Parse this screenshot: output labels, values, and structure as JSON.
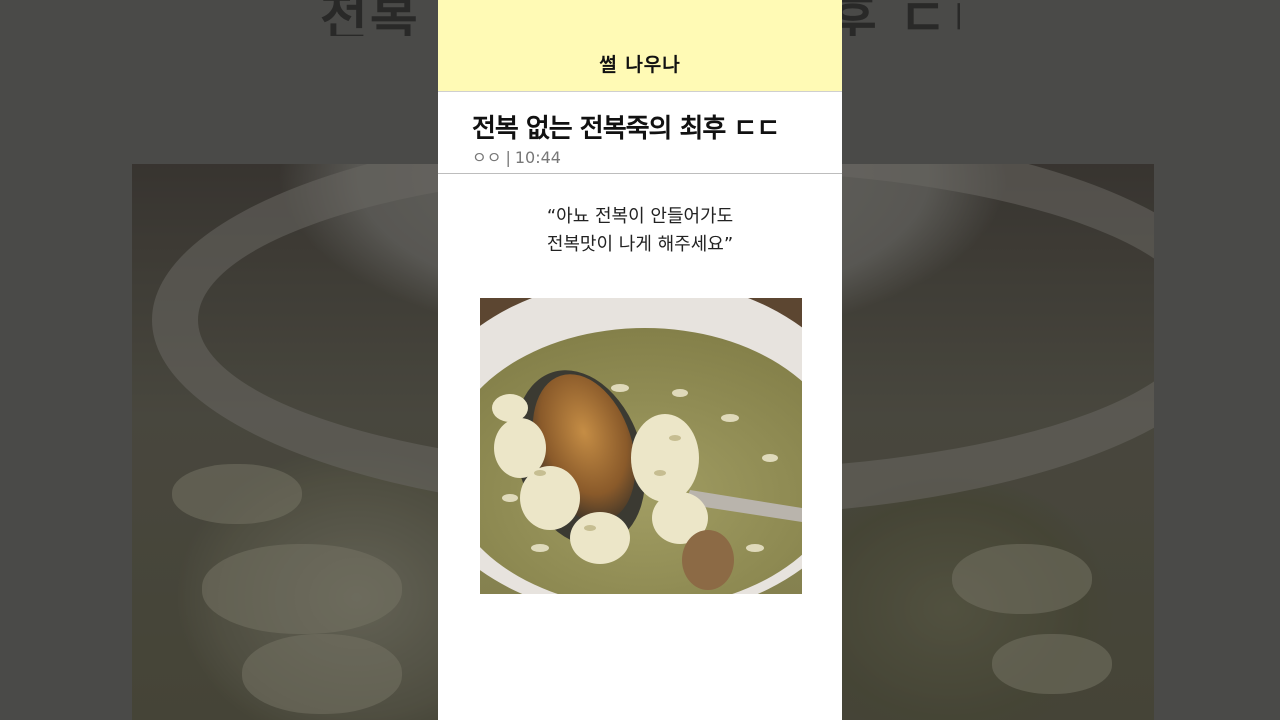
{
  "brand": {
    "name": "썰 나우나"
  },
  "post": {
    "title": "전복 없는 전복죽의 최후 ㄷㄷ",
    "author": "ㅇㅇ",
    "separator": "|",
    "time": "10:44"
  },
  "quote": {
    "line1": "“아뇨 전복이 안들어가도",
    "line2": "전복맛이 나게 해주세요”"
  },
  "background": {
    "title_fragment": "전복 없는 전복죽의 최후 ㄷㄷ"
  },
  "image": {
    "subject": "abalone-porridge-photo"
  },
  "colors": {
    "brand_bar": "#fffab5",
    "page_backdrop": "#4a4a48"
  }
}
